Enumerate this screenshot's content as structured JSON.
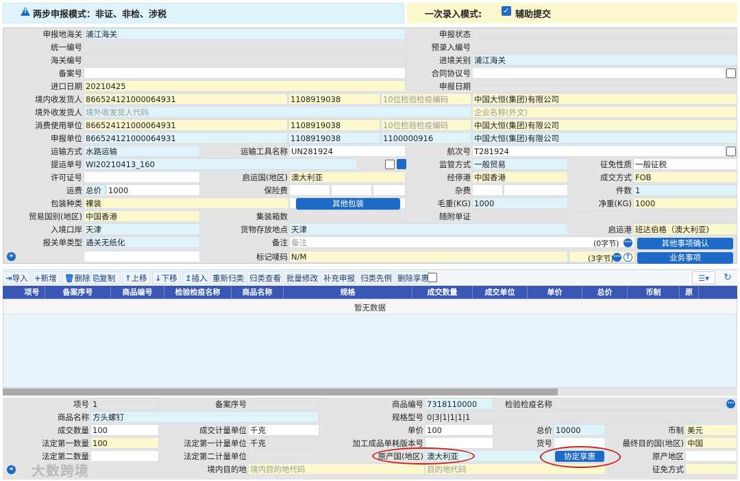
{
  "header": {
    "mode_title": "两步申报模式：非证、非检、涉税",
    "entry_mode_label": "一次录入模式:",
    "assist_submit_label": "辅助提交"
  },
  "form": {
    "r1": {
      "l1": "申报地海关",
      "v1": "浦江海关",
      "l2": "申报状态"
    },
    "r2": {
      "l1": "统一编号",
      "l2": "预录入编号"
    },
    "r3": {
      "l1": "海关编号",
      "l2": "进境关别",
      "v2": "浦江海关"
    },
    "r4": {
      "l1": "备案号",
      "l2": "合同协议号"
    },
    "r5": {
      "l1": "进口日期",
      "v1": "20210425",
      "l2": "申报日期"
    },
    "r6": {
      "l1": "境内收发货人",
      "v1": "866524121000064931",
      "v2": "1108919038",
      "v3": "10位检验检疫编码",
      "v4": "中国大恒(集团)有限公司"
    },
    "r7": {
      "l1": "境外收发货人",
      "v1": "境外收发货人代码",
      "v4": "企业名称(外文)"
    },
    "r8": {
      "l1": "消费使用单位",
      "v1": "866524121000064931",
      "v2": "1108919038",
      "v3": "10位检验检疫编码",
      "v4": "中国大恒(集团)有限公司"
    },
    "r9": {
      "l1": "申报单位",
      "v1": "866524121000064931",
      "v2": "1108919038",
      "v3": "1100000916",
      "v4": "中国大恒(集团)有限公司"
    },
    "r10": {
      "l1": "运输方式",
      "v1": "水路运输",
      "l2": "运输工具名称",
      "v2": "UN281924",
      "l3": "航次号",
      "v3": "T281924"
    },
    "r11": {
      "l1": "提运单号",
      "v1": "WI20210413_160",
      "l2": "监管方式",
      "v2": "一般贸易",
      "l3": "征免性质",
      "v3": "一般征税"
    },
    "r12": {
      "l1": "许可证号",
      "l2": "启运国(地区)",
      "v2": "澳大利亚",
      "l3": "经停港",
      "v3": "中国香港",
      "l4": "成交方式",
      "v4": "FOB"
    },
    "r13": {
      "l1": "运费",
      "v1a": "总价",
      "v1b": "1000",
      "l2": "保险费",
      "l3": "杂费",
      "l4": "件数",
      "v4": "1"
    },
    "r14": {
      "l1": "包装种类",
      "v1": "裸装",
      "btn": "其他包装",
      "l3": "毛重(KG)",
      "v3": "1000",
      "l4": "净重(KG)",
      "v4": "1000"
    },
    "r15": {
      "l1": "贸易国别(地区)",
      "v1": "中国香港",
      "l2": "集装箱数",
      "l3": "随附单证"
    },
    "r16": {
      "l1": "入境口岸",
      "v1": "天津",
      "l2": "货物存放地点",
      "v2": "天津",
      "l4": "启运港",
      "v4": "班达伯格（澳大利亚)"
    },
    "r17": {
      "l1": "报关单类型",
      "v1": "通关无纸化",
      "l2": "备注",
      "v2": "备注",
      "count": "(0字节)",
      "btn": "其他事项确认"
    },
    "r18": {
      "l2": "标记唛码",
      "v2": "N/M",
      "count": "(3字节)",
      "btn": "业务事项"
    }
  },
  "toolbar": [
    "导入",
    "新增",
    "删除",
    "复制",
    "上移",
    "下移",
    "插入",
    "重新归类",
    "归类查看",
    "批量修改",
    "补充申报",
    "归类先例",
    "删除享惠"
  ],
  "table": {
    "headers": [
      "项号",
      "备案序号",
      "商品编号",
      "检验检疫名称",
      "商品名称",
      "规格",
      "成交数量",
      "成交单位",
      "单价",
      "总价",
      "币制",
      "原"
    ],
    "empty": "暂无数据"
  },
  "item": {
    "i1": {
      "l1": "项号",
      "v1": "1",
      "l2": "备案序号",
      "l3": "商品编号",
      "v3": "7318110000",
      "l4": "检验检疫名称"
    },
    "i2": {
      "l1": "商品名称",
      "v1": "方头螺钉",
      "l3": "规格型号",
      "v3": "0|3|1|1|1|1"
    },
    "i3": {
      "l1": "成交数量",
      "v1": "100",
      "l2": "成交计量单位",
      "v2": "千克",
      "l3": "单价",
      "v3": "100",
      "l4": "总价",
      "v4": "10000",
      "l5": "币制",
      "v5": "美元"
    },
    "i4": {
      "l1": "法定第一数量",
      "v1": "100",
      "l2": "法定第一计量单位",
      "v2": "千克",
      "l3": "加工成品单耗版本号",
      "l4": "货号",
      "l5": "最终目的国(地区)",
      "v5": "中国"
    },
    "i5": {
      "l1": "法定第二数量",
      "l2": "法定第二计量单位",
      "l3": "原产国(地区)",
      "v3": "澳大利亚",
      "btn": "协定享惠",
      "l5": "原产地区"
    },
    "i6": {
      "l2": "境内目的地",
      "v2": "境内目的地代码",
      "v3": "目的地代码",
      "l5": "征免方式"
    }
  },
  "watermark": "大数跨境",
  "colors": {
    "blue": "#1d6bc7",
    "header": "#3a57b5",
    "cyan": "#dff4fa",
    "yellow": "#fdf9cf",
    "grey": "#e4e4e4",
    "red": "#d0201b"
  }
}
